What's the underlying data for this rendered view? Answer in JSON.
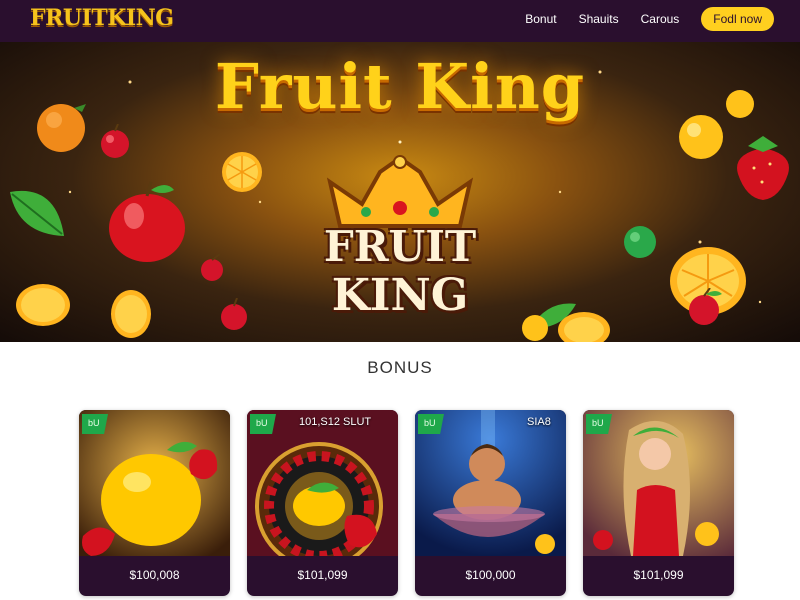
{
  "header": {
    "logo": "FRUITKING",
    "nav": [
      "Bonut",
      "Shauits",
      "Carous"
    ],
    "cta_label": "Fodl now"
  },
  "hero": {
    "title": "Fruit King",
    "logo_line_1": "FRUIT",
    "logo_line_2": "KING"
  },
  "bonus": {
    "title": "BONUS",
    "cards": [
      {
        "badge": "bU",
        "tag": "",
        "price": "$100,008",
        "art": "lemon-strawberries"
      },
      {
        "badge": "bU",
        "tag": "101,S12   SLUT",
        "price": "$101,099",
        "art": "roulette-wheel"
      },
      {
        "badge": "bU",
        "tag": "SIA8",
        "price": "$100,000",
        "art": "man-in-bowl"
      },
      {
        "badge": "bU",
        "tag": "",
        "price": "$101,099",
        "art": "lady-with-fruits"
      }
    ]
  },
  "colors": {
    "header_bg": "#2a0f2e",
    "accent": "#ffcf1f",
    "gold": "#ffd21a",
    "badge_green": "#1fa84a"
  }
}
